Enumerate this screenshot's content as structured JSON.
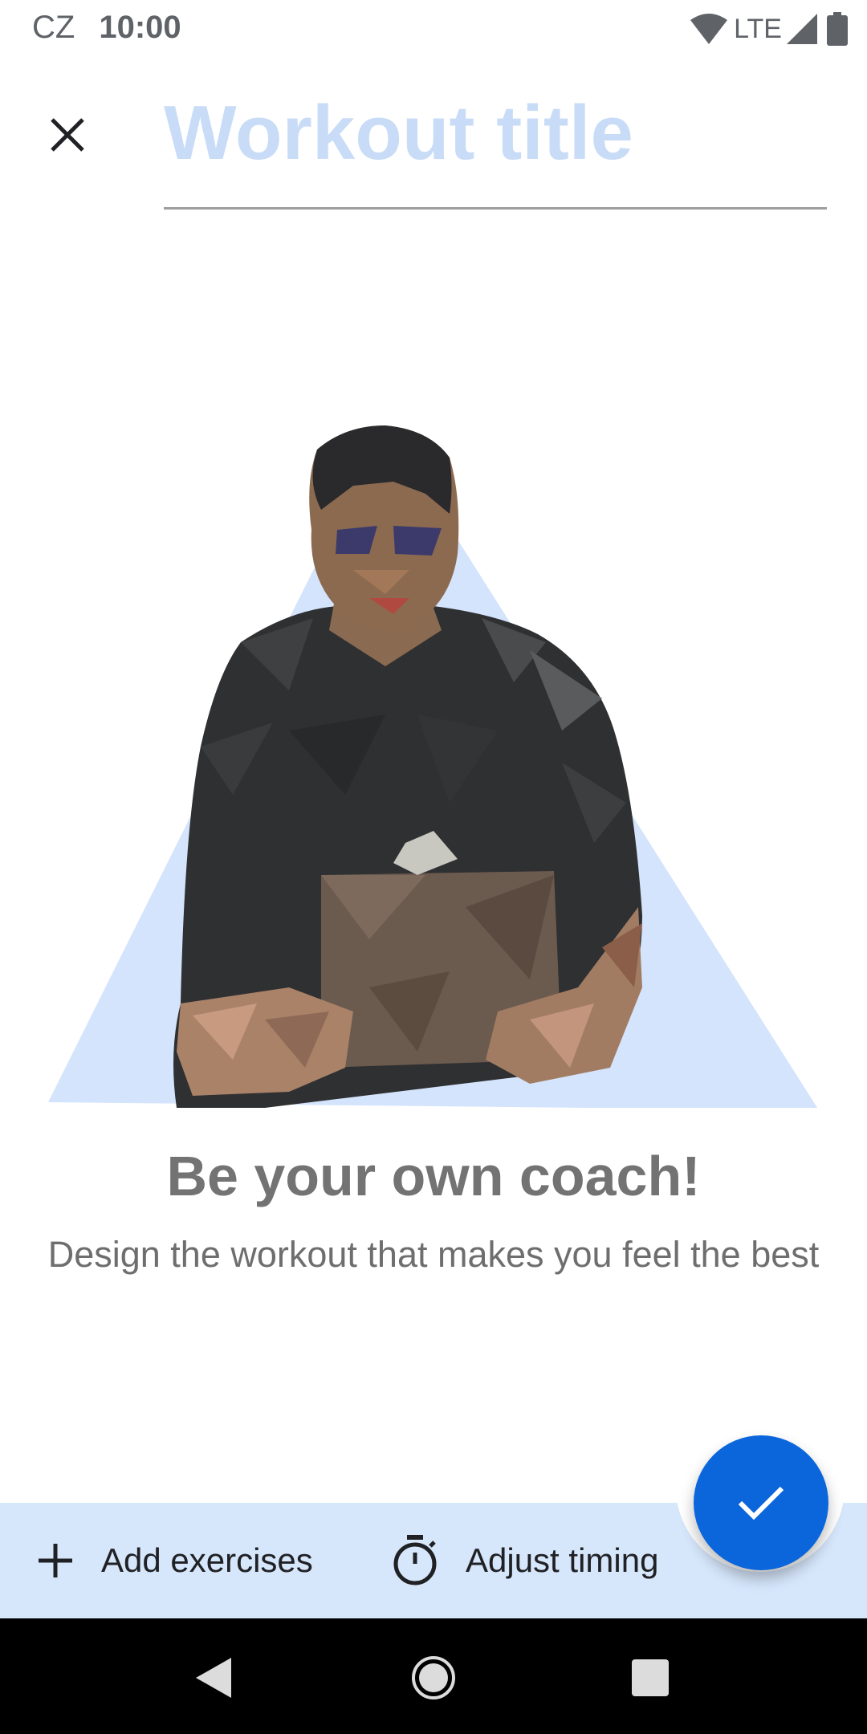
{
  "status_bar": {
    "carrier": "CZ",
    "time": "10:00",
    "network": "LTE",
    "icons": [
      "wifi-icon",
      "signal-icon",
      "battery-icon"
    ]
  },
  "header": {
    "close_icon": "close-icon",
    "title_placeholder": "Workout title"
  },
  "empty_state": {
    "headline": "Be your own coach!",
    "subline": "Design the workout that makes you feel the best"
  },
  "bottom_bar": {
    "add_exercises_label": "Add exercises",
    "add_icon": "plus-icon",
    "adjust_timing_label": "Adjust timing",
    "timing_icon": "stopwatch-icon",
    "fab_icon": "check-icon"
  },
  "nav_bar": {
    "buttons": [
      "back-icon",
      "home-icon",
      "recents-icon"
    ]
  },
  "colors": {
    "accent": "#0b66dc",
    "bar_background": "#d6e6fb",
    "placeholder": "#c9dcf7",
    "triangle": "#d4e4fc"
  }
}
